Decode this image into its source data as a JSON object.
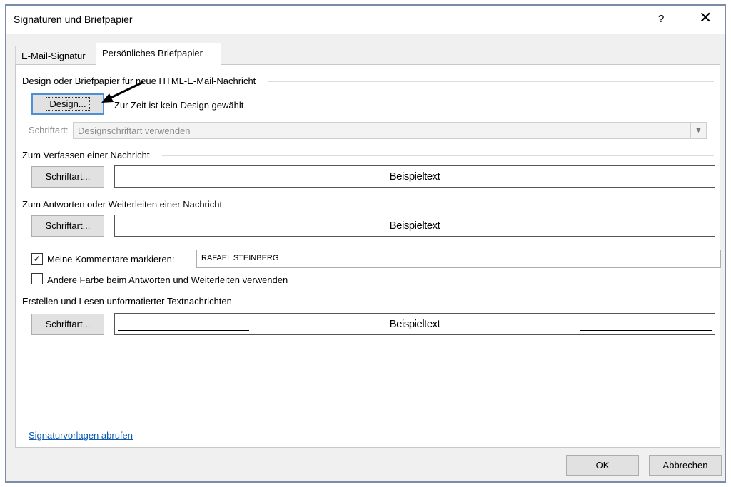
{
  "window": {
    "title": "Signaturen und Briefpapier",
    "help_label": "?",
    "close_label": "✕"
  },
  "tabs": [
    {
      "label": "E-Mail-Signatur",
      "active": false
    },
    {
      "label": "Persönliches Briefpapier",
      "active": true
    }
  ],
  "design_section": {
    "title": "Design oder Briefpapier für neue HTML-E-Mail-Nachricht",
    "design_button": "Design...",
    "status_text": "Zur Zeit ist kein Design gewählt",
    "font_label": "Schriftart:",
    "font_value": "Designschriftart verwenden"
  },
  "compose_section": {
    "title": "Zum Verfassen einer Nachricht",
    "font_button": "Schriftart...",
    "sample_text": "Beispieltext"
  },
  "reply_section": {
    "title": "Zum Antworten oder Weiterleiten einer Nachricht",
    "font_button": "Schriftart...",
    "sample_text": "Beispieltext",
    "mark_comments_label": "Meine Kommentare markieren:",
    "mark_comments_checked": true,
    "mark_comments_value": "RAFAEL STEINBERG",
    "other_color_label": "Andere Farbe beim Antworten und Weiterleiten verwenden",
    "other_color_checked": false
  },
  "plain_section": {
    "title": "Erstellen und Lesen unformatierter Textnachrichten",
    "font_button": "Schriftart...",
    "sample_text": "Beispieltext"
  },
  "link_text": "Signaturvorlagen abrufen",
  "footer": {
    "ok_label": "OK",
    "cancel_label": "Abbrechen"
  },
  "colors": {
    "link": "#0c5bb0",
    "focus_border": "#4b90d8",
    "arrow": "#000000"
  }
}
